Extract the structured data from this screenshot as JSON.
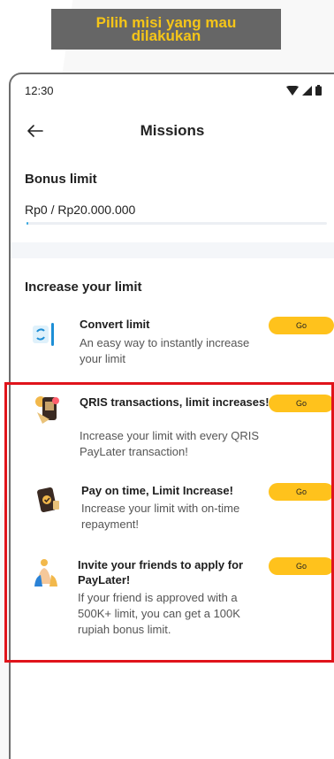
{
  "caption": {
    "text": "Pilih misi yang mau dilakukan"
  },
  "status_bar": {
    "time": "12:30",
    "icons": [
      "wifi-icon",
      "signal-icon",
      "battery-icon"
    ]
  },
  "header": {
    "title": "Missions",
    "back_icon": "arrow-left-icon"
  },
  "bonus": {
    "label": "Bonus limit",
    "value": "Rp0 / Rp20.000.000",
    "progress_fraction": 0.005
  },
  "section": {
    "title": "Increase your limit"
  },
  "missions": [
    {
      "title": "Convert limit",
      "description": "An easy way to instantly increase your limit",
      "button": "Go",
      "icon": "convert-limit-icon"
    },
    {
      "title": "QRIS transactions, limit increases!",
      "description": "Increase your limit with every QRIS PayLater transaction!",
      "button": "Go",
      "icon": "qris-phone-icon"
    },
    {
      "title": "Pay on time, Limit Increase!",
      "description": "Increase your limit with on-time repayment!",
      "button": "Go",
      "icon": "pay-on-time-icon"
    },
    {
      "title": "Invite your friends to apply for PayLater!",
      "description": "If your friend is approved with a 500K+ limit, you can get a 100K rupiah bonus limit.",
      "button": "Go",
      "icon": "invite-friends-icon"
    }
  ],
  "colors": {
    "accent": "#ffc21c",
    "highlight": "#e0141b",
    "caption_text": "#f5c518",
    "progress": "#35a7e0"
  }
}
